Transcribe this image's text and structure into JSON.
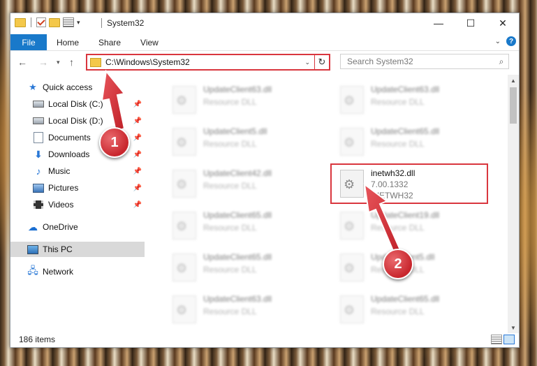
{
  "window": {
    "title": "System32",
    "controls": {
      "minimize": "—",
      "maximize": "☐",
      "close": "✕"
    }
  },
  "ribbon": {
    "tabs": [
      "File",
      "Home",
      "Share",
      "View"
    ],
    "help_label": "?"
  },
  "address": {
    "path": "C:\\Windows\\System32",
    "refresh_icon": "refresh-icon"
  },
  "search": {
    "placeholder": "Search System32"
  },
  "nav": {
    "items": [
      {
        "label": "Quick access",
        "icon": "star-icon",
        "pinned": false
      },
      {
        "label": "Local Disk (C:)",
        "icon": "drive-icon",
        "pinned": true
      },
      {
        "label": "Local Disk (D:)",
        "icon": "drive-icon",
        "pinned": true
      },
      {
        "label": "Documents",
        "icon": "documents-icon",
        "pinned": true
      },
      {
        "label": "Downloads",
        "icon": "downloads-icon",
        "pinned": true
      },
      {
        "label": "Music",
        "icon": "music-icon",
        "pinned": true
      },
      {
        "label": "Pictures",
        "icon": "pictures-icon",
        "pinned": true
      },
      {
        "label": "Videos",
        "icon": "videos-icon",
        "pinned": true
      },
      {
        "label": "OneDrive",
        "icon": "onedrive-icon",
        "pinned": false
      },
      {
        "label": "This PC",
        "icon": "this-pc-icon",
        "pinned": false,
        "selected": true
      },
      {
        "label": "Network",
        "icon": "network-icon",
        "pinned": false
      }
    ]
  },
  "files": [
    {
      "name": "UpdateClient63.dll",
      "type": "Resource DLL"
    },
    {
      "name": "UpdateClient63.dll",
      "type": "Resource DLL"
    },
    {
      "name": "UpdateClient5.dll",
      "type": "Resource DLL"
    },
    {
      "name": "UpdateClient65.dll",
      "type": "Resource DLL"
    },
    {
      "name": "UpdateClient42.dll",
      "type": "Resource DLL"
    },
    {
      "name": "inetwh32.dll",
      "version": "7.00.1332",
      "type": "INETWH32"
    },
    {
      "name": "UpdateClient65.dll",
      "type": "Resource DLL"
    },
    {
      "name": "UpdateClient19.dll",
      "type": "Resource DLL"
    },
    {
      "name": "UpdateClient65.dll",
      "type": "Resource DLL"
    },
    {
      "name": "UpdateClient5.dll",
      "type": "Resource DLL"
    },
    {
      "name": "UpdateClient63.dll",
      "type": "Resource DLL"
    },
    {
      "name": "UpdateClient65.dll",
      "type": "Resource DLL"
    }
  ],
  "status": {
    "item_count": "186 items"
  },
  "annotations": {
    "badge1": "1",
    "badge2": "2"
  },
  "colors": {
    "accent": "#1979ca",
    "highlight": "#d9363e"
  }
}
